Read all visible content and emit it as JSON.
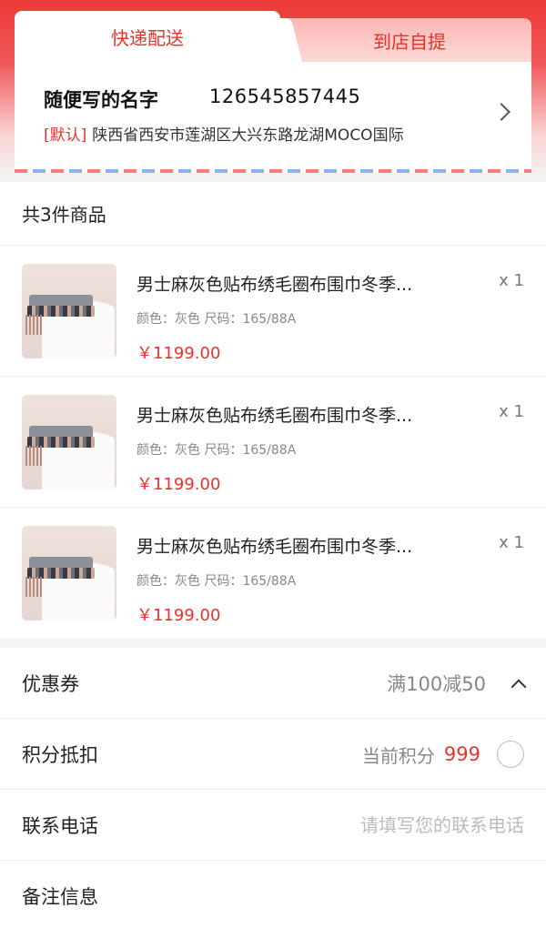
{
  "delivery_tabs": {
    "express_label": "快递配送",
    "pickup_label": "到店自提"
  },
  "address": {
    "name": "随便写的名字",
    "phone": "126545857445",
    "default_tag": "[默认]",
    "detail": "陕西省西安市莲湖区大兴东路龙湖MOCO国际"
  },
  "goods": {
    "header": "共3件商品",
    "items": [
      {
        "title": "男士麻灰色贴布绣毛圈布围巾冬季...",
        "spec": "颜色：灰色   尺码：165/88A",
        "price": "￥1199.00",
        "qty": "x 1"
      },
      {
        "title": "男士麻灰色贴布绣毛圈布围巾冬季...",
        "spec": "颜色：灰色   尺码：165/88A",
        "price": "￥1199.00",
        "qty": "x 1"
      },
      {
        "title": "男士麻灰色贴布绣毛圈布围巾冬季...",
        "spec": "颜色：灰色   尺码：165/88A",
        "price": "￥1199.00",
        "qty": "x 1"
      }
    ]
  },
  "coupon": {
    "label": "优惠券",
    "value": "满100减50"
  },
  "points": {
    "label": "积分抵扣",
    "current_label": "当前积分",
    "current_value": "999"
  },
  "contact": {
    "label": "联系电话",
    "placeholder": "请填写您的联系电话"
  },
  "remark": {
    "label": "备注信息"
  },
  "colors": {
    "accent": "#e8332d",
    "header_red": "#ec3a36"
  }
}
